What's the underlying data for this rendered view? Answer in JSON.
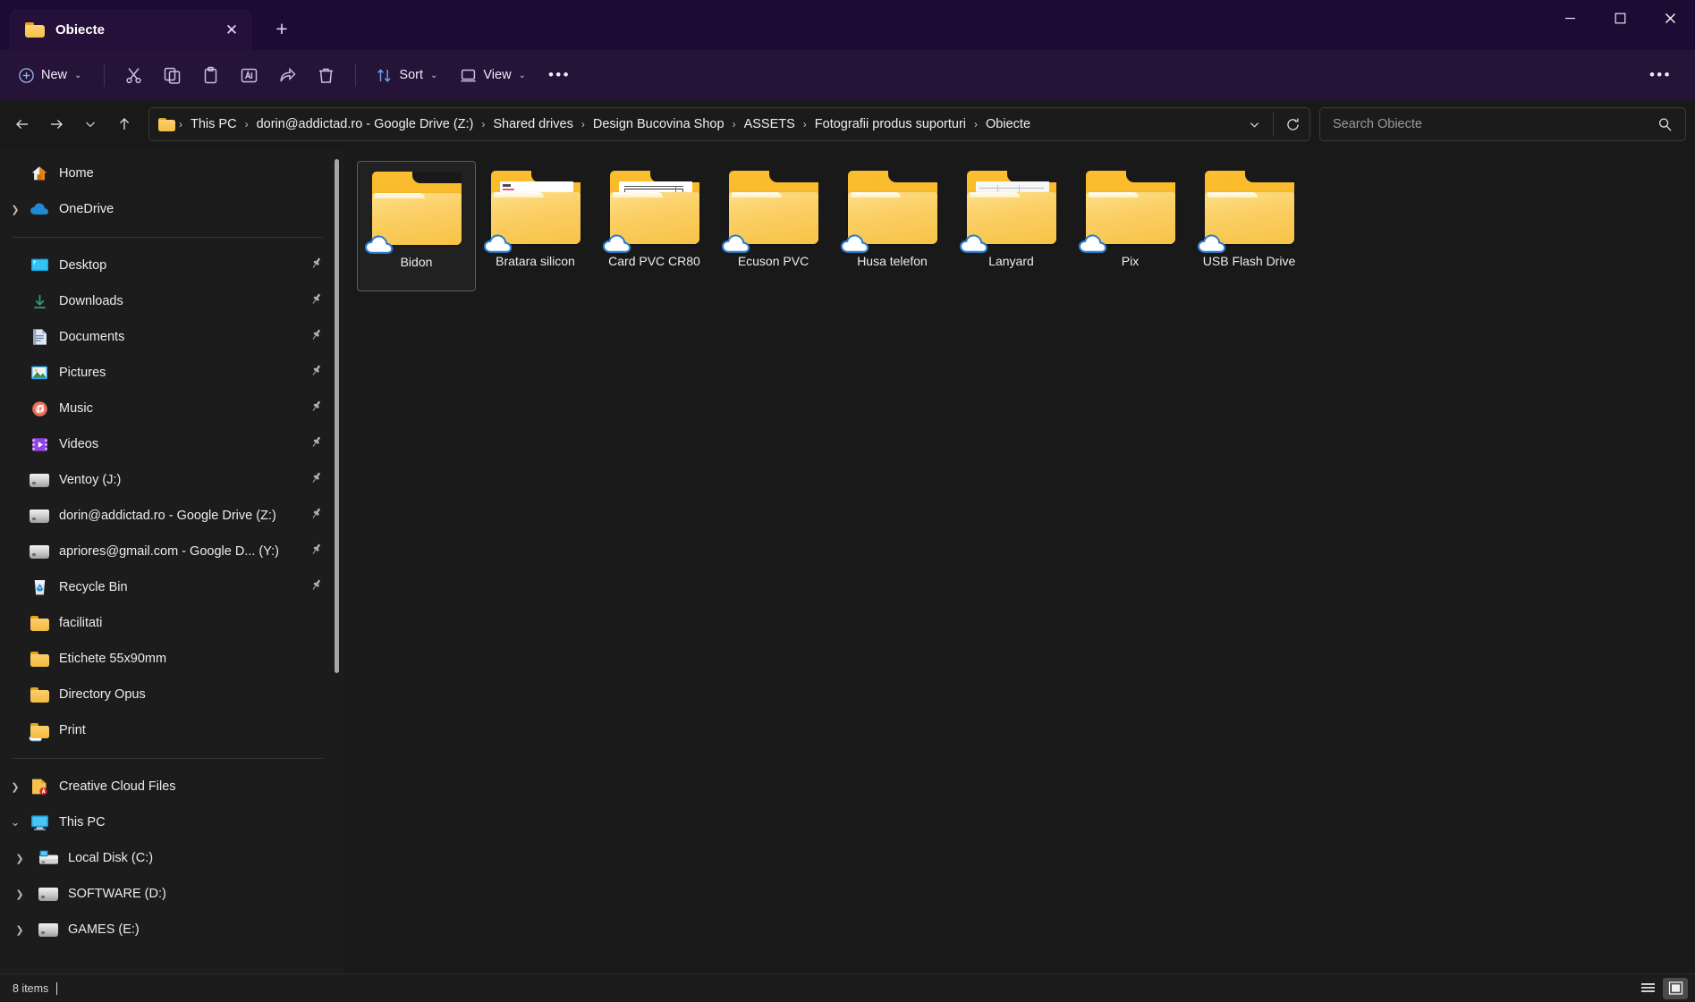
{
  "window": {
    "tab_title": "Obiecte",
    "tab_close_label": "✕",
    "new_tab_label": "+",
    "minimize_label": "minimize",
    "maximize_label": "maximize",
    "close_label": "close"
  },
  "toolbar": {
    "new_label": "New",
    "sort_label": "Sort",
    "view_label": "View",
    "more_label": "•••",
    "cut_label": "Cut",
    "copy_label": "Copy",
    "paste_label": "Paste",
    "rename_label": "Rename",
    "share_label": "Share",
    "delete_label": "Delete",
    "chevron": "⌄"
  },
  "addressbar": {
    "back_label": "Back",
    "forward_label": "Forward",
    "recent_label": "Recent locations",
    "up_label": "Up",
    "refresh_label": "Refresh",
    "breadcrumbs": [
      "This PC",
      "dorin@addictad.ro - Google Drive (Z:)",
      "Shared drives",
      "Design Bucovina Shop",
      "ASSETS",
      "Fotografii produs suporturi",
      "Obiecte"
    ],
    "separator": "›"
  },
  "search": {
    "placeholder": "Search Obiecte",
    "value": ""
  },
  "sidebar": {
    "groups": [
      {
        "items": [
          {
            "label": "Home",
            "icon": "home-icon",
            "twisty": "",
            "pinned": false
          },
          {
            "label": "OneDrive",
            "icon": "cloud-icon",
            "twisty": "›",
            "pinned": false
          }
        ]
      },
      {
        "items": [
          {
            "label": "Desktop",
            "icon": "desktop-icon",
            "twisty": "",
            "pinned": true
          },
          {
            "label": "Downloads",
            "icon": "download-icon",
            "twisty": "",
            "pinned": true
          },
          {
            "label": "Documents",
            "icon": "document-icon",
            "twisty": "",
            "pinned": true
          },
          {
            "label": "Pictures",
            "icon": "pictures-icon",
            "twisty": "",
            "pinned": true
          },
          {
            "label": "Music",
            "icon": "music-icon",
            "twisty": "",
            "pinned": true
          },
          {
            "label": "Videos",
            "icon": "video-icon",
            "twisty": "",
            "pinned": true
          },
          {
            "label": "Ventoy (J:)",
            "icon": "drive-icon",
            "twisty": "",
            "pinned": true
          },
          {
            "label": "dorin@addictad.ro - Google Drive (Z:)",
            "icon": "drive-icon",
            "twisty": "",
            "pinned": true
          },
          {
            "label": "apriores@gmail.com - Google D... (Y:)",
            "icon": "drive-icon",
            "twisty": "",
            "pinned": true
          },
          {
            "label": "Recycle Bin",
            "icon": "recycle-bin-icon",
            "twisty": "",
            "pinned": true
          },
          {
            "label": "facilitati",
            "icon": "folder-icon",
            "twisty": "",
            "pinned": false
          },
          {
            "label": "Etichete 55x90mm",
            "icon": "folder-icon",
            "twisty": "",
            "pinned": false
          },
          {
            "label": "Directory Opus",
            "icon": "folder-icon",
            "twisty": "",
            "pinned": false
          },
          {
            "label": "Print",
            "icon": "folder-cloud-icon",
            "twisty": "",
            "pinned": false
          }
        ]
      },
      {
        "items": [
          {
            "label": "Creative Cloud Files",
            "icon": "creative-cloud-icon",
            "twisty": "›",
            "pinned": false
          },
          {
            "label": "This PC",
            "icon": "this-pc-icon",
            "twisty": "⌄",
            "pinned": false
          },
          {
            "label": "Local Disk (C:)",
            "icon": "system-drive-icon",
            "twisty": "›",
            "pinned": false,
            "indent": 1
          },
          {
            "label": "SOFTWARE (D:)",
            "icon": "drive-icon",
            "twisty": "›",
            "pinned": false,
            "indent": 1
          },
          {
            "label": "GAMES (E:)",
            "icon": "drive-icon",
            "twisty": "›",
            "pinned": false,
            "indent": 1
          }
        ]
      }
    ]
  },
  "content": {
    "items": [
      {
        "name": "Bidon",
        "selected": true,
        "preview": "none",
        "cloud": true
      },
      {
        "name": "Bratara silicon",
        "selected": false,
        "preview": "technical-drawing",
        "cloud": true
      },
      {
        "name": "Card PVC CR80",
        "selected": false,
        "preview": "dimension-drawing",
        "cloud": true
      },
      {
        "name": "Ecuson PVC",
        "selected": false,
        "preview": "none",
        "cloud": true
      },
      {
        "name": "Husa telefon",
        "selected": false,
        "preview": "none",
        "cloud": true
      },
      {
        "name": "Lanyard",
        "selected": false,
        "preview": "spreadsheet",
        "cloud": true
      },
      {
        "name": "Pix",
        "selected": false,
        "preview": "none",
        "cloud": true
      },
      {
        "name": "USB Flash Drive",
        "selected": false,
        "preview": "none",
        "cloud": true
      }
    ]
  },
  "statusbar": {
    "item_count": "8 items",
    "details_view_label": "Details view",
    "large_icons_view_label": "Large icons view",
    "active_view": "large-icons"
  },
  "colors": {
    "titlebar_bg": "#1c0b33",
    "toolbar_bg": "#261338",
    "panel_bg": "#1c1c1c",
    "content_bg": "#191919",
    "folder_yellow": "#f8c246",
    "accent_blue": "#4a9eea",
    "text_primary": "#ececec"
  }
}
